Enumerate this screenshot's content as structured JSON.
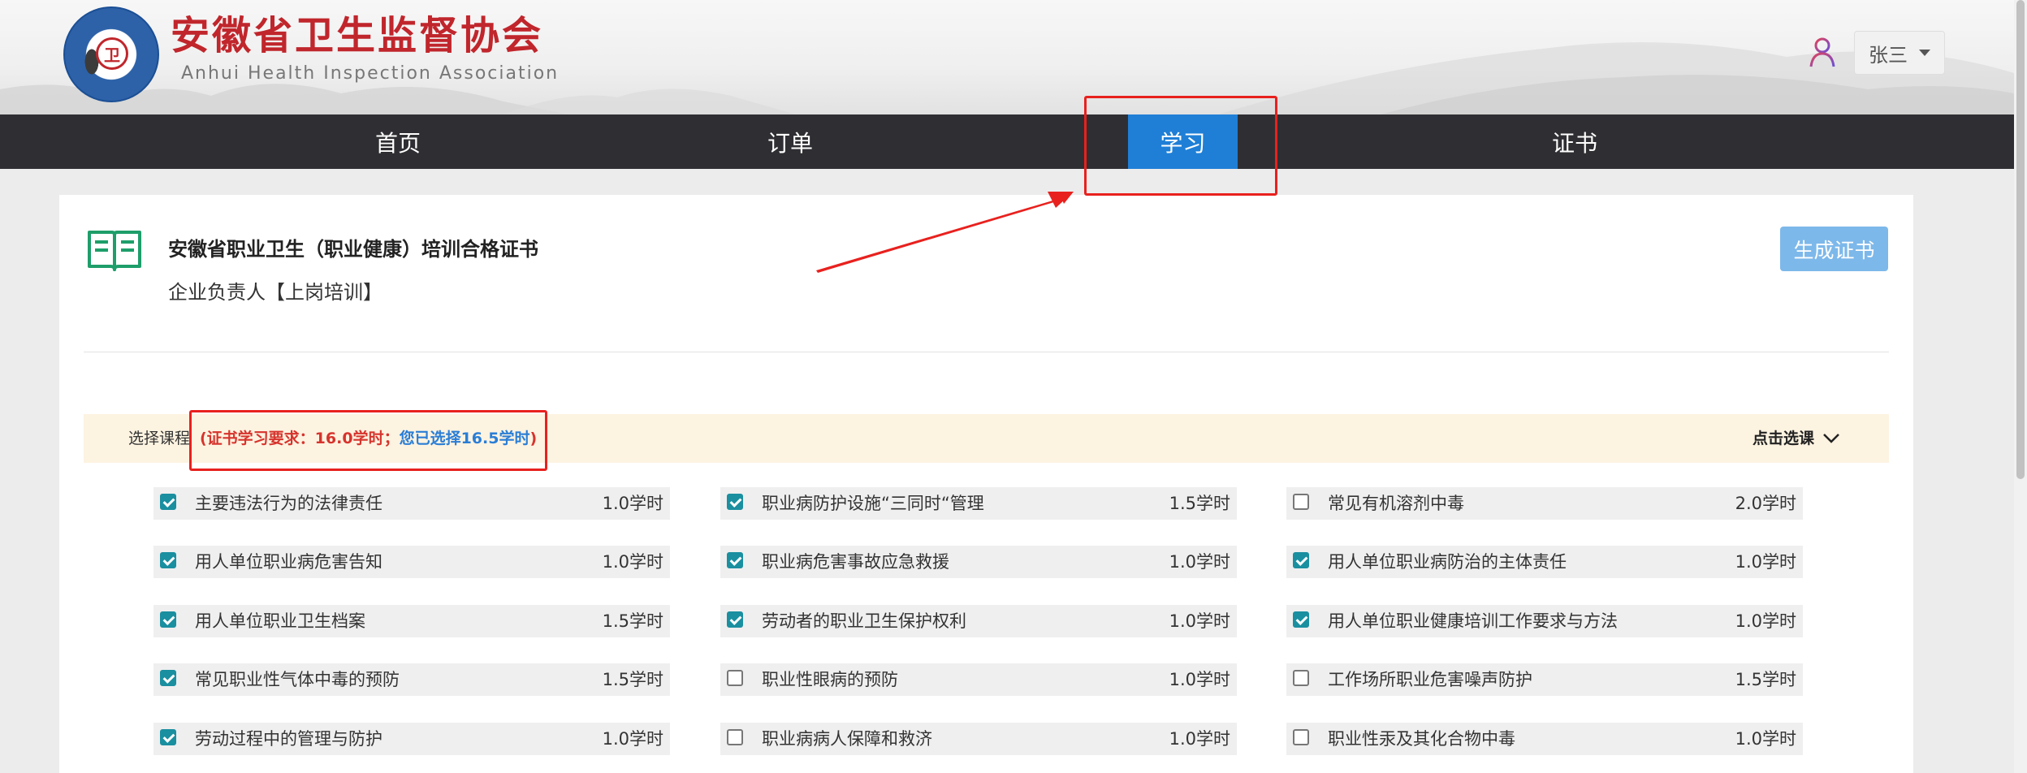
{
  "header": {
    "org_name_cn": "安徽省卫生监督协会",
    "org_name_en": "Anhui  Health  Inspection  Association",
    "logo_icon": "association-seal-logo",
    "user_icon": "user-icon",
    "user_name": "张三"
  },
  "nav": {
    "items": [
      {
        "label": "首页",
        "active": false
      },
      {
        "label": "订单",
        "active": false
      },
      {
        "label": "学习",
        "active": true
      },
      {
        "label": "证书",
        "active": false
      }
    ]
  },
  "certificate": {
    "icon": "open-book-icon",
    "title": "安徽省职业卫生（职业健康）培训合格证书",
    "subtitle": "企业负责人【上岗培训】",
    "generate_button": "生成证书"
  },
  "selection": {
    "label": "选择课程",
    "requirement_prefix": "(证书学习要求：16.0学时；",
    "selected_text": "您已选择16.5学时",
    "requirement_suffix": ")",
    "choose_button": "点击选课"
  },
  "courses": [
    {
      "name": "主要违法行为的法律责任",
      "hours": "1.0学时",
      "checked": true
    },
    {
      "name": "职业病防护设施“三同时“管理",
      "hours": "1.5学时",
      "checked": true
    },
    {
      "name": "常见有机溶剂中毒",
      "hours": "2.0学时",
      "checked": false
    },
    {
      "name": "用人单位职业病危害告知",
      "hours": "1.0学时",
      "checked": true
    },
    {
      "name": "职业病危害事故应急救援",
      "hours": "1.0学时",
      "checked": true
    },
    {
      "name": "用人单位职业病防治的主体责任",
      "hours": "1.0学时",
      "checked": true
    },
    {
      "name": "用人单位职业卫生档案",
      "hours": "1.5学时",
      "checked": true
    },
    {
      "name": "劳动者的职业卫生保护权利",
      "hours": "1.0学时",
      "checked": true
    },
    {
      "name": "用人单位职业健康培训工作要求与方法",
      "hours": "1.0学时",
      "checked": true
    },
    {
      "name": "常见职业性气体中毒的预防",
      "hours": "1.5学时",
      "checked": true
    },
    {
      "name": "职业性眼病的预防",
      "hours": "1.0学时",
      "checked": false
    },
    {
      "name": "工作场所职业危害噪声防护",
      "hours": "1.5学时",
      "checked": false
    },
    {
      "name": "劳动过程中的管理与防护",
      "hours": "1.0学时",
      "checked": true
    },
    {
      "name": "职业病病人保障和救济",
      "hours": "1.0学时",
      "checked": false
    },
    {
      "name": "职业性汞及其化合物中毒",
      "hours": "1.0学时",
      "checked": false
    }
  ],
  "colors": {
    "brand_red": "#c0262c",
    "nav_bg": "#2f2f33",
    "nav_active": "#1f7fd6",
    "checkbox_on": "#1a8fa0",
    "annotation_red": "#e8211e"
  }
}
